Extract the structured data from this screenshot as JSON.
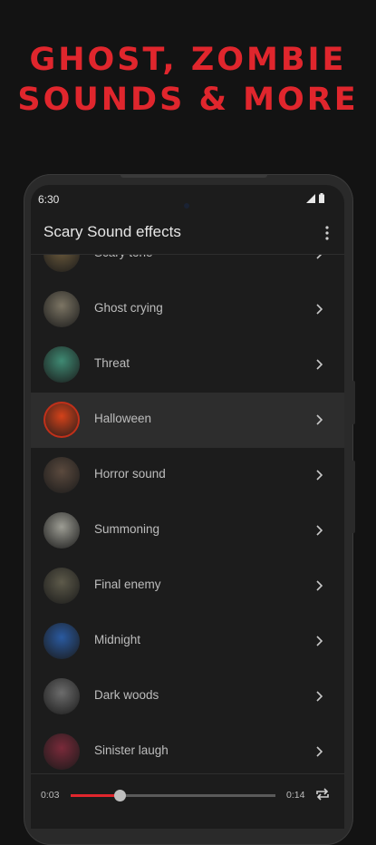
{
  "promo": {
    "line1": "GHOST, ZOMBIE",
    "line2": "SOUNDS & MORE",
    "color": "#e0262d"
  },
  "status_bar": {
    "time": "6:30",
    "icons": [
      "signal-icon",
      "battery-icon"
    ]
  },
  "app_bar": {
    "title": "Scary Sound effects",
    "menu_icon": "more-vert-icon"
  },
  "sounds": [
    {
      "label": "Scary tone",
      "thumb": "#6b5a3c",
      "active": false
    },
    {
      "label": "Ghost crying",
      "thumb": "#7c7564",
      "active": false
    },
    {
      "label": "Threat",
      "thumb": "#3f8a73",
      "active": false
    },
    {
      "label": "Halloween",
      "thumb": "#d4421a",
      "active": true
    },
    {
      "label": "Horror sound",
      "thumb": "#5b4a3e",
      "active": false
    },
    {
      "label": "Summoning",
      "thumb": "#9d9d94",
      "active": false
    },
    {
      "label": "Final enemy",
      "thumb": "#5d5a4a",
      "active": false
    },
    {
      "label": "Midnight",
      "thumb": "#2a5aa0",
      "active": false
    },
    {
      "label": "Dark woods",
      "thumb": "#6c6c6c",
      "active": false
    },
    {
      "label": "Sinister laugh",
      "thumb": "#7a2a3a",
      "active": false
    }
  ],
  "player": {
    "current_time": "0:03",
    "total_time": "0:14",
    "progress": 0.24,
    "repeat_icon": "repeat-icon"
  }
}
